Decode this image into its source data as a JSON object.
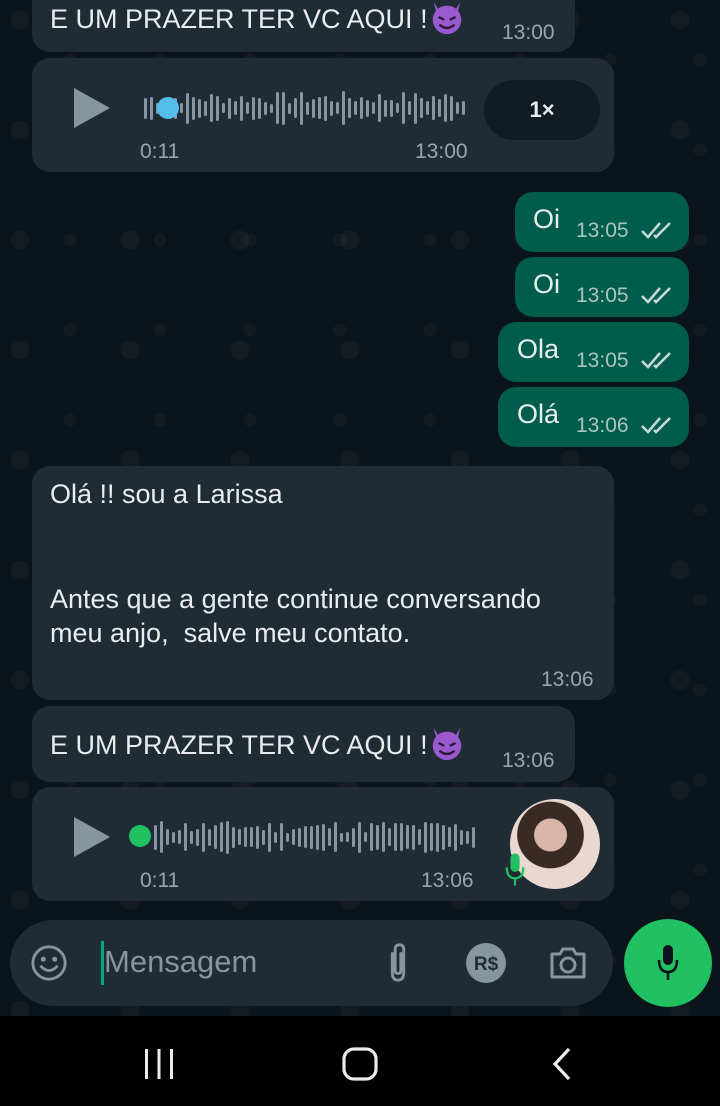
{
  "messages": [
    {
      "type": "text",
      "dir": "in",
      "text": "E UM PRAZER TER VC AQUI !",
      "time": "13:00"
    },
    {
      "type": "audio",
      "dir": "in",
      "duration": "0:11",
      "time": "13:00",
      "speed": "1×"
    },
    {
      "type": "text",
      "dir": "out",
      "text": "Oi",
      "time": "13:05"
    },
    {
      "type": "text",
      "dir": "out",
      "text": "Oi",
      "time": "13:05"
    },
    {
      "type": "text",
      "dir": "out",
      "text": "Ola",
      "time": "13:05"
    },
    {
      "type": "text",
      "dir": "out",
      "text": "Olá",
      "time": "13:06"
    },
    {
      "type": "text",
      "dir": "in",
      "line1": "Olá !! sou a Larissa",
      "line2": "Antes que a gente continue conversando",
      "line3": "meu anjo,  salve meu contato.",
      "time": "13:06"
    },
    {
      "type": "text",
      "dir": "in",
      "text": "E UM PRAZER TER VC AQUI !",
      "time": "13:06"
    },
    {
      "type": "audio",
      "dir": "in",
      "duration": "0:11",
      "time": "13:06"
    }
  ],
  "composer": {
    "placeholder": "Mensagem"
  },
  "colors": {
    "incoming": "#1f2c34",
    "outgoing": "#005c4b",
    "accent": "#21c063",
    "played": "#53bdeb",
    "read_ticks": "#e9edef"
  },
  "icons": [
    "devil-emoji-icon",
    "play-icon",
    "double-check-icon",
    "microphone-icon",
    "emoji-icon",
    "attach-icon",
    "payment-icon",
    "camera-icon",
    "recents-nav-icon",
    "home-nav-icon",
    "back-nav-icon"
  ]
}
